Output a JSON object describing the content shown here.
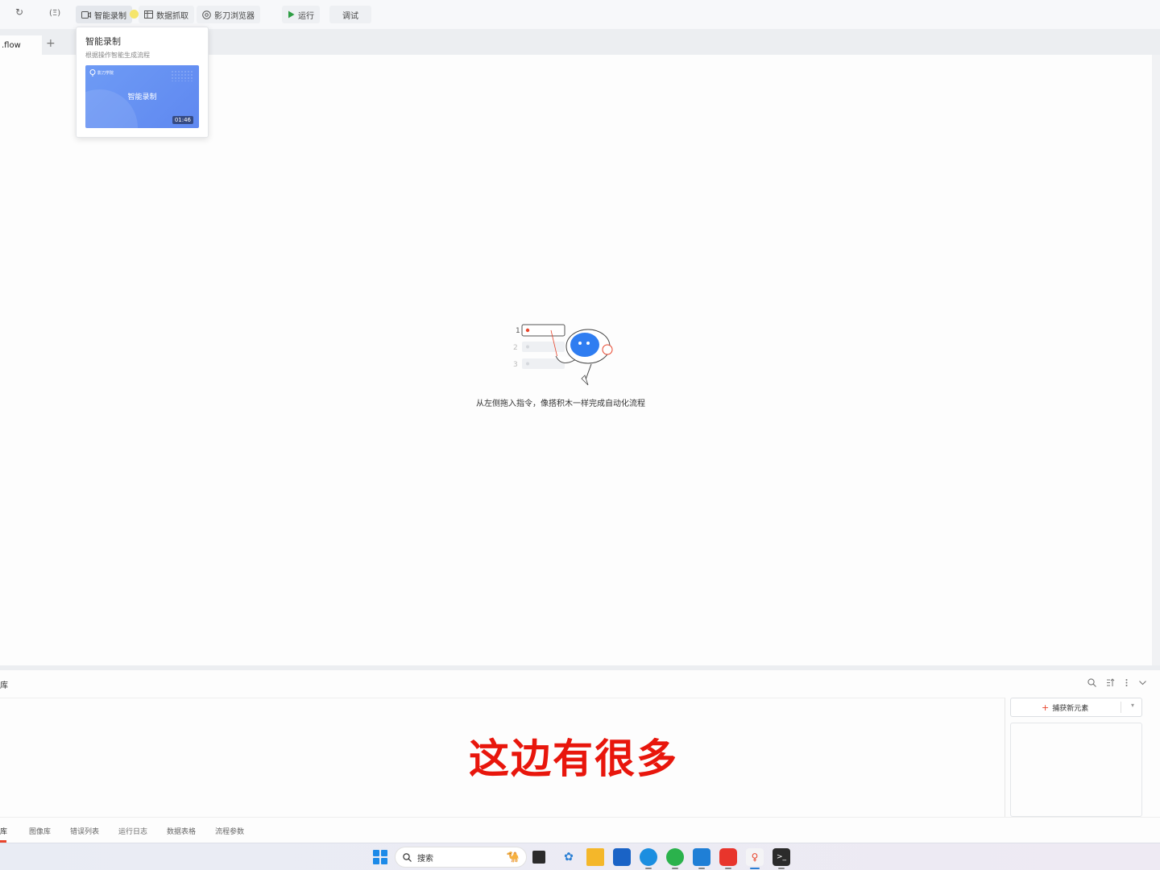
{
  "toolbar": {
    "redo_icon": "↻",
    "var_icon": "(Ξ)",
    "smart_record": "智能录制",
    "data_capture": "数据抓取",
    "browser": "影刀浏览器",
    "run": "运行",
    "debug": "调试"
  },
  "tabs": {
    "active": ".flow",
    "add": "+"
  },
  "popover": {
    "title": "智能录制",
    "subtitle": "根据操作智能生成流程",
    "video_logo": "影刀学院",
    "video_title": "智能录制",
    "duration": "01:46"
  },
  "canvas": {
    "steps": [
      "1",
      "2",
      "3"
    ],
    "empty_text": "从左侧拖入指令，像搭积木一样完成自动化流程"
  },
  "bottom_panel": {
    "header_label": "库",
    "capture_button": "捕获新元素",
    "overlay_text": "这边有很多",
    "tabs": [
      "库",
      "图像库",
      "错误列表",
      "运行日志",
      "数据表格",
      "流程参数"
    ]
  },
  "taskbar": {
    "search_placeholder": "搜索"
  },
  "colors": {
    "accent_red": "#e8160c",
    "video_blue": "#6e9bf5",
    "run_green": "#2e9e44"
  }
}
